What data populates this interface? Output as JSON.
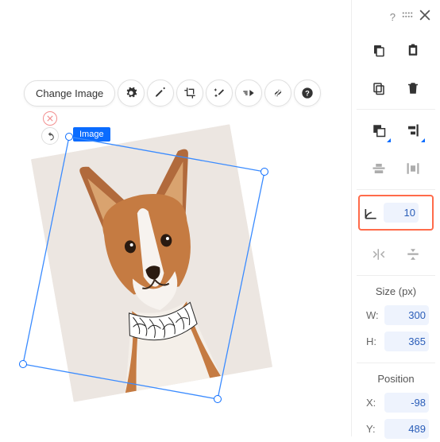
{
  "toolbar": {
    "change_image": "Change Image"
  },
  "selection": {
    "label": "Image"
  },
  "rotation": {
    "value": "10"
  },
  "size": {
    "title": "Size (px)",
    "w_label": "W:",
    "w_value": "300",
    "h_label": "H:",
    "h_value": "365"
  },
  "position": {
    "title": "Position",
    "x_label": "X:",
    "x_value": "-98",
    "y_label": "Y:",
    "y_value": "489"
  }
}
